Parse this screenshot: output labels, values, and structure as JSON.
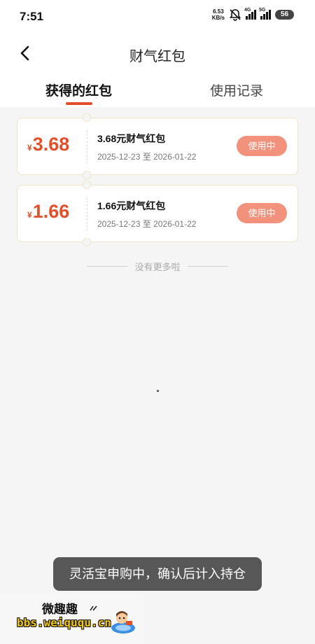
{
  "status_bar": {
    "time": "7:51",
    "net_speed_value": "6.53",
    "net_speed_unit": "KB/s",
    "sim1_tag": "4G",
    "sim2_tag": "5G",
    "battery": "56"
  },
  "header": {
    "title": "财气红包",
    "back_icon": "chevron-left-icon"
  },
  "tabs": [
    {
      "label": "获得的红包",
      "active": true
    },
    {
      "label": "使用记录",
      "active": false
    }
  ],
  "coupons": [
    {
      "currency": "¥",
      "amount": "3.68",
      "title": "3.68元财气红包",
      "validity": "2025-12-23 至 2026-01-22",
      "status": "使用中"
    },
    {
      "currency": "¥",
      "amount": "1.66",
      "title": "1.66元财气红包",
      "validity": "2025-12-23 至 2026-01-22",
      "status": "使用中"
    }
  ],
  "list_end_text": "没有更多啦",
  "toast": "灵活宝申购中，确认后计入持仓",
  "watermark": {
    "title": "微趣趣",
    "url": "bbs.weiququ.cn"
  },
  "colors": {
    "accent": "#e2502b",
    "badge": "#f2917c",
    "card_border": "#f1e3c8",
    "page_bg": "#f5f5f5"
  }
}
